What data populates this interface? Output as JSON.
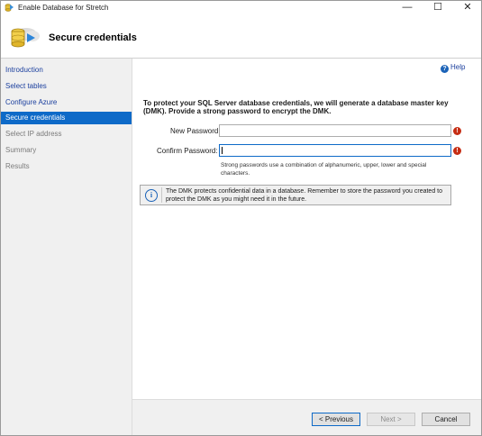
{
  "window": {
    "title": "Enable Database for Stretch",
    "controls": {
      "minimize": "—",
      "maximize": "☐",
      "close": "✕"
    }
  },
  "header": {
    "title": "Secure credentials",
    "icon": "database-wizard-icon"
  },
  "nav": {
    "items": [
      {
        "label": "Introduction",
        "state": "link"
      },
      {
        "label": "Select tables",
        "state": "link"
      },
      {
        "label": "Configure Azure",
        "state": "link"
      },
      {
        "label": "Secure credentials",
        "state": "selected"
      },
      {
        "label": "Select IP address",
        "state": "disabled"
      },
      {
        "label": "Summary",
        "state": "disabled"
      },
      {
        "label": "Results",
        "state": "disabled"
      }
    ]
  },
  "content": {
    "help_label": "Help",
    "help_icon": "help-icon",
    "intro": "To protect your SQL Server database credentials, we will generate a database master key (DMK). Provide a strong password to encrypt the DMK.",
    "new_password_label": "New Password:",
    "new_password_value": "",
    "confirm_password_label": "Confirm Password:",
    "confirm_password_value": "",
    "error_icon": "error-icon",
    "hint": "Strong passwords use a combination of alphanumeric, upper, lower and special characters.",
    "info_icon": "info-icon",
    "info_text": "The DMK protects confidential data in a database. Remember to store the password you created to protect the DMK as you might need it in the future."
  },
  "footer": {
    "previous": "< Previous",
    "next": "Next >",
    "cancel": "Cancel"
  },
  "colors": {
    "selection": "#0e6ac8",
    "link": "#1b3f9e",
    "error": "#c62d14",
    "info": "#1b63b8"
  }
}
